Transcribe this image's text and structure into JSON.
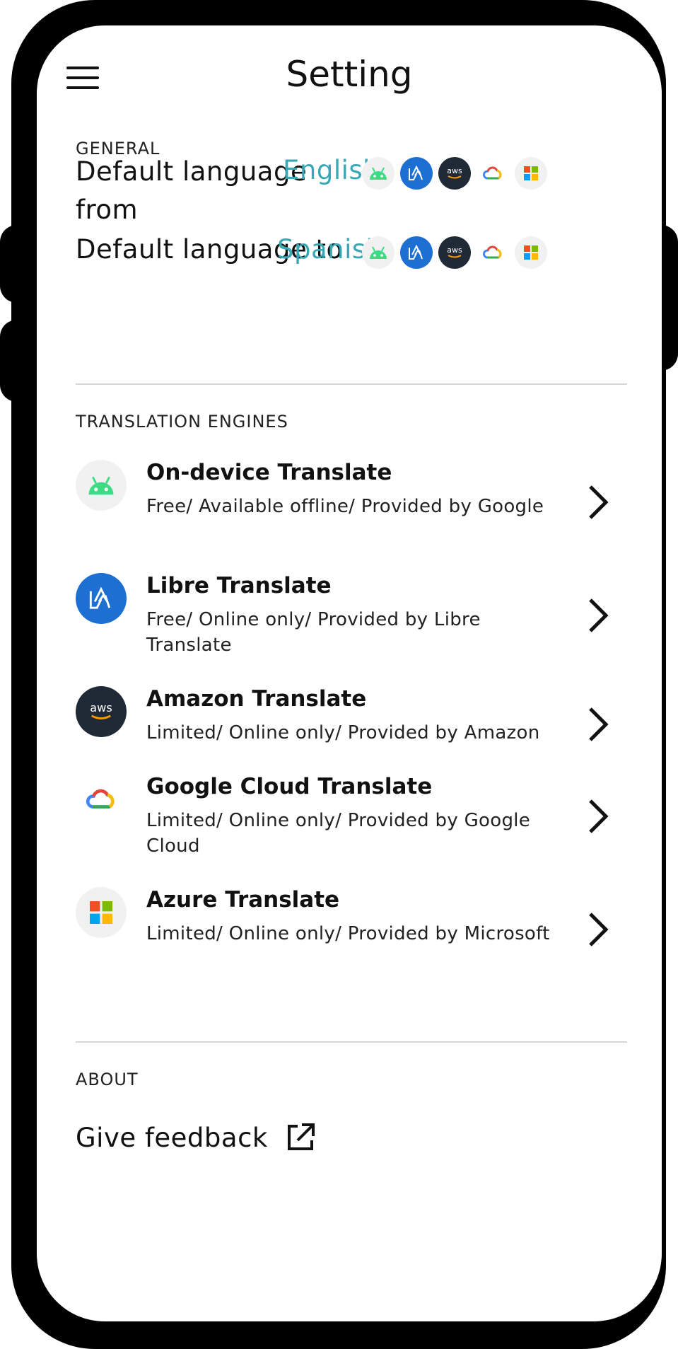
{
  "header": {
    "title": "Setting"
  },
  "general": {
    "section_label": "GENERAL",
    "from": {
      "label": "Default language from",
      "value": "English"
    },
    "to": {
      "label": "Default language to",
      "value": "Spanish"
    }
  },
  "engines": {
    "section_label": "TRANSLATION ENGINES",
    "items": [
      {
        "name": "On-device Translate",
        "desc": "Free/ Available offline/ Provided by Google",
        "icon": "android-icon"
      },
      {
        "name": "Libre Translate",
        "desc": "Free/ Online only/ Provided by Libre Translate",
        "icon": "libre-translate-icon"
      },
      {
        "name": "Amazon Translate",
        "desc": "Limited/ Online only/ Provided by Amazon",
        "icon": "aws-icon"
      },
      {
        "name": "Google Cloud Translate",
        "desc": "Limited/ Online only/ Provided by Google Cloud",
        "icon": "google-cloud-icon"
      },
      {
        "name": "Azure Translate",
        "desc": "Limited/ Online only/ Provided by Microsoft",
        "icon": "microsoft-icon"
      }
    ]
  },
  "about": {
    "section_label": "ABOUT",
    "feedback_label": "Give feedback"
  },
  "colors": {
    "accent": "#3aa8b4",
    "android_green": "#3ddc84",
    "libre_blue": "#1d6fd1",
    "aws_dark": "#1f2a36"
  },
  "aws_text": "aws"
}
